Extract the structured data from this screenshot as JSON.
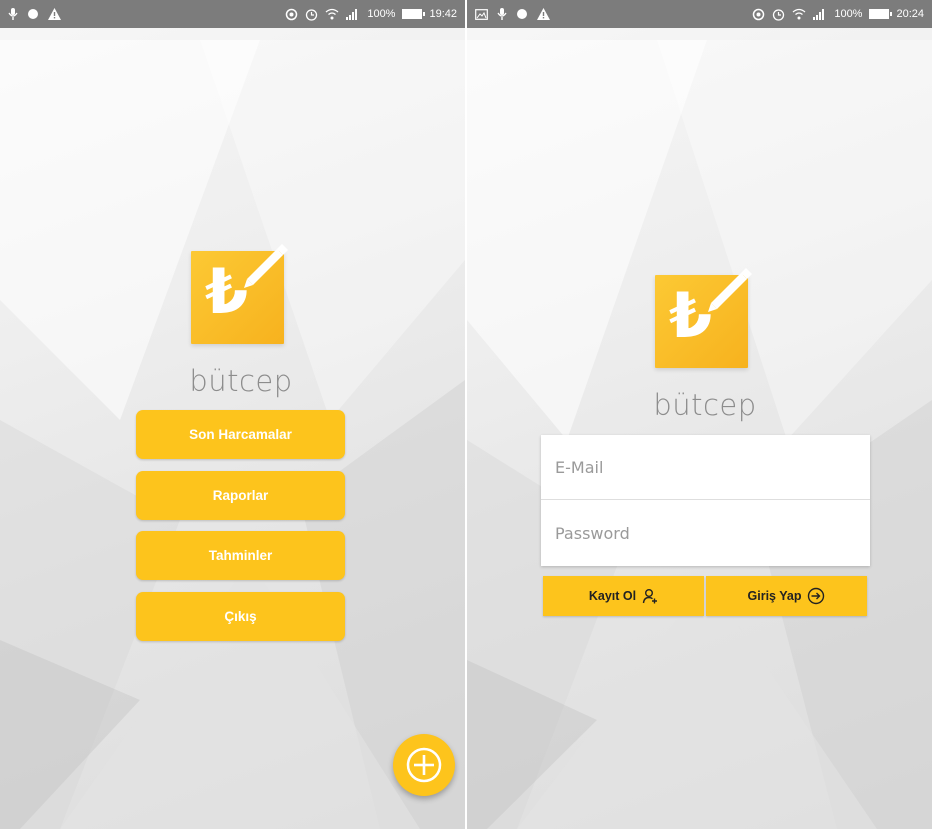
{
  "left_screen": {
    "statusbar": {
      "battery_percent": "100%",
      "time": "19:42"
    },
    "app_name": "bütcep",
    "logo_glyph": "₺",
    "menu": {
      "items": [
        {
          "label": "Son Harcamalar"
        },
        {
          "label": "Raporlar"
        },
        {
          "label": "Tahminler"
        },
        {
          "label": "Çıkış"
        }
      ]
    },
    "fab_icon": "plus-circle-icon"
  },
  "right_screen": {
    "statusbar": {
      "battery_percent": "100%",
      "time": "20:24"
    },
    "app_name": "bütcep",
    "logo_glyph": "₺",
    "form": {
      "email_placeholder": "E-Mail",
      "password_placeholder": "Password"
    },
    "buttons": {
      "register_label": "Kayıt Ol",
      "login_label": "Giriş Yap"
    }
  },
  "colors": {
    "accent": "#fdc41c",
    "statusbar": "#7c7c7c",
    "app_name": "#8c8c8c"
  }
}
